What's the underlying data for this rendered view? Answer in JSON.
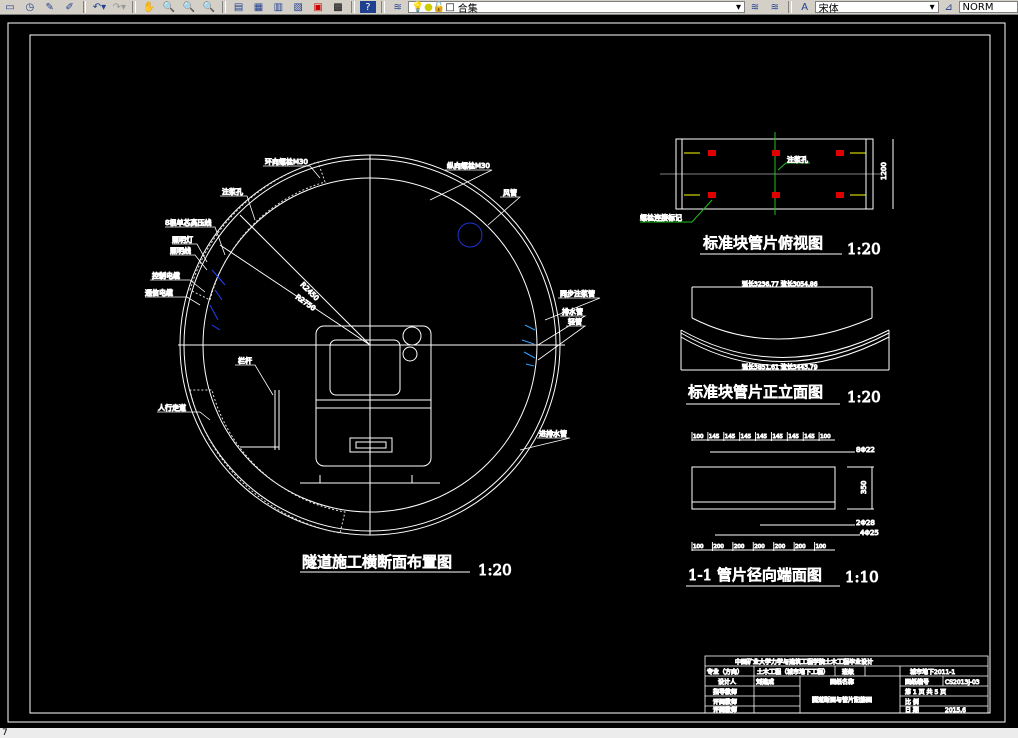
{
  "toolbar": {
    "layer_name": "合集",
    "font_name": "宋体",
    "style_name": "NORM"
  },
  "status": {
    "command": "7"
  },
  "drawing": {
    "main_title": "隧道施工横断面布置图",
    "main_scale": "1:20",
    "labels": {
      "ring_bolt": "环向螺栓M30",
      "long_bolt": "纵向螺栓M30",
      "grout_hole": "注浆孔",
      "hv_cable": "8根单芯高压线",
      "light": "照明灯",
      "light_line": "照明线",
      "control_cable": "控制电缆",
      "comm_cable": "通信电缆",
      "railing": "栏杆",
      "walkway": "人行走道",
      "air_duct": "风管",
      "sync_grout": "同步注浆管",
      "drain": "排水管",
      "pipe": "轻管",
      "water_pipe": "进排水管"
    },
    "dims": {
      "r1": "R2450",
      "r2": "R2750"
    },
    "plan": {
      "title": "标准块管片俯视图",
      "scale": "1:20",
      "grout_hole": "注浆孔",
      "bolt_mark": "螺栓连接标记",
      "width": "1200"
    },
    "elevation": {
      "title": "标准块管片正立面图",
      "scale": "1:20",
      "top_dim": "弧长3236.77 弦长3054.86",
      "bottom_dim": "弧长3851.61 弦长3443.79"
    },
    "section": {
      "title": "1-1 管片径向端面图",
      "scale": "1:10",
      "top_dims": [
        "100",
        "145",
        "145",
        "145",
        "145",
        "145",
        "145",
        "145",
        "100"
      ],
      "bottom_dims": [
        "100",
        "200",
        "200",
        "200",
        "200",
        "200",
        "100"
      ],
      "rebar1": "8Φ22",
      "rebar2": "2Φ28",
      "rebar3": "4Φ25",
      "height": "350"
    }
  },
  "title_block": {
    "school": "中国矿业大学力学与建筑工程学院土木工程毕业设计",
    "major_label": "专业（方向）",
    "major": "土木工程（城市地下工程）",
    "class_label": "班级",
    "class": "城市地下2011-1",
    "designer_label": "设计人",
    "designer": "刘建成",
    "drawing_name_label": "图纸名称",
    "drawing_no_label": "图纸编号",
    "drawing_no": "CS2013J-03",
    "advisor_label": "指导教师",
    "reviewer1_label": "评阅教师",
    "reviewer2_label": "评阅教师",
    "drawing_name": "隧道断面与管片配筋图",
    "page": "第 1 页 共 5 页",
    "scale_label": "比 例",
    "date_label": "日 期",
    "date": "2015.6"
  }
}
